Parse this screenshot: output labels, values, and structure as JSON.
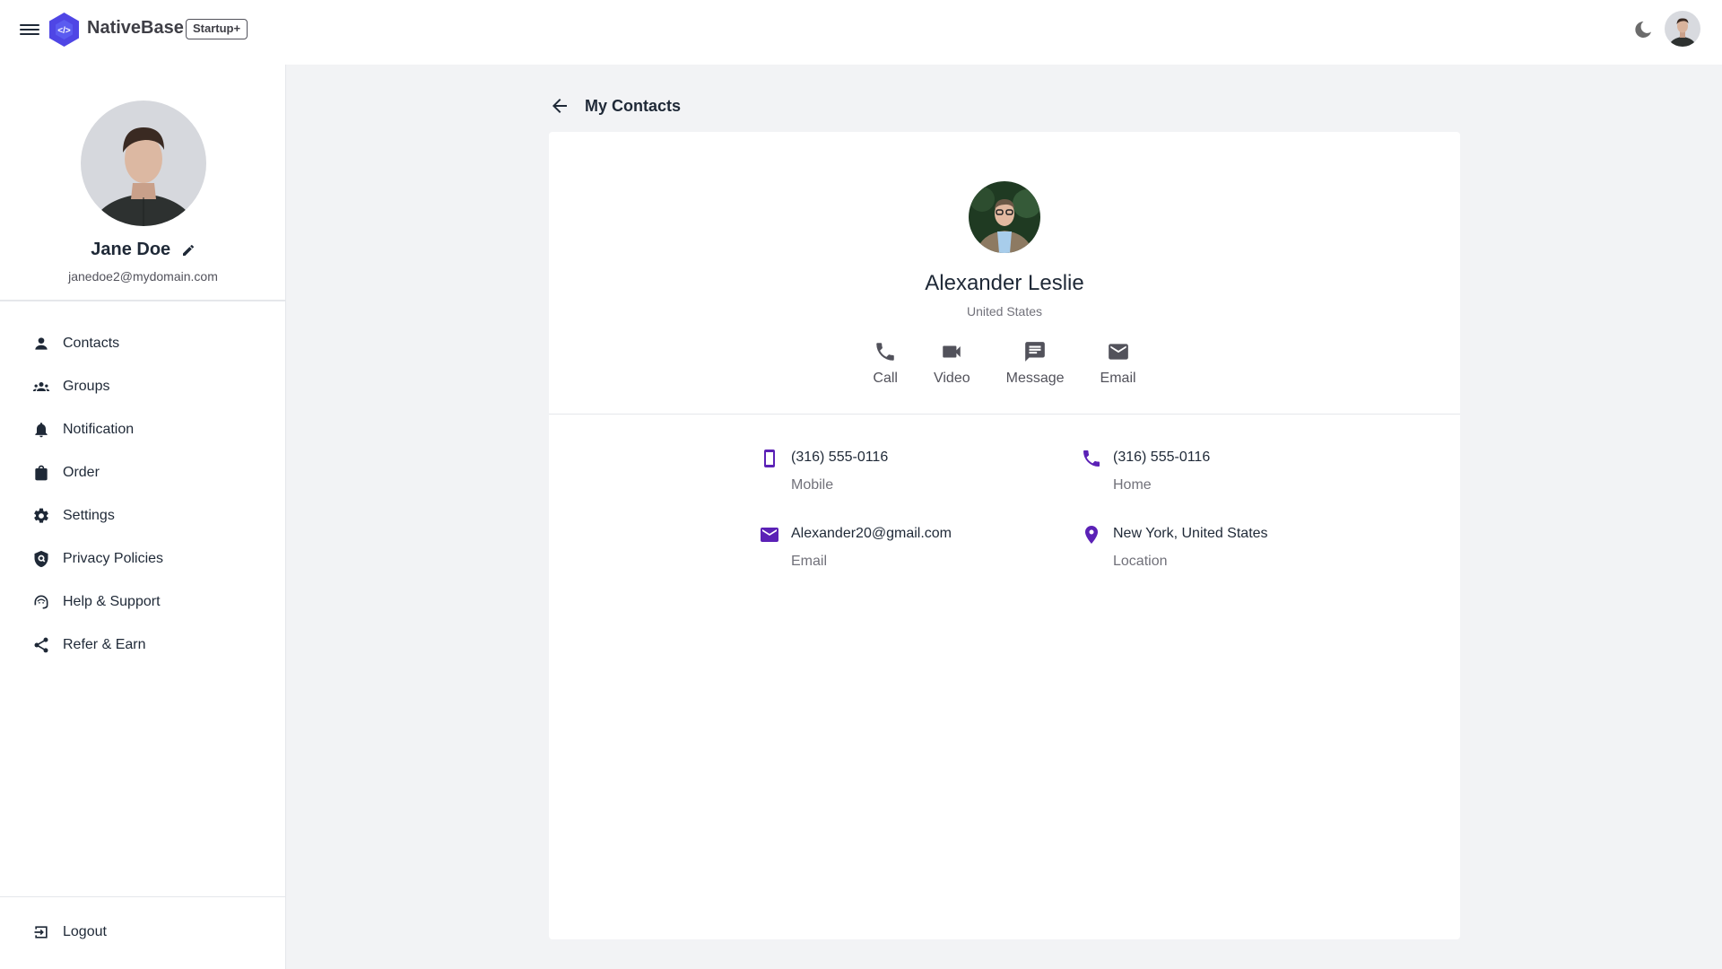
{
  "header": {
    "brand": "NativeBase",
    "plan_badge": "Startup+",
    "theme_toggle_icon": "moon-icon",
    "menu_icon": "hamburger-icon"
  },
  "sidebar": {
    "profile": {
      "name": "Jane Doe",
      "email": "janedoe2@mydomain.com"
    },
    "items": [
      {
        "label": "Contacts",
        "icon": "person-icon"
      },
      {
        "label": "Groups",
        "icon": "groups-icon"
      },
      {
        "label": "Notification",
        "icon": "bell-icon"
      },
      {
        "label": "Order",
        "icon": "shopping-bag-icon"
      },
      {
        "label": "Settings",
        "icon": "gear-icon"
      },
      {
        "label": "Privacy Policies",
        "icon": "shield-icon"
      },
      {
        "label": "Help & Support",
        "icon": "headset-icon"
      },
      {
        "label": "Refer & Earn",
        "icon": "share-icon"
      }
    ],
    "logout": {
      "label": "Logout",
      "icon": "logout-icon"
    }
  },
  "main": {
    "back_title": "My Contacts",
    "contact": {
      "name": "Alexander Leslie",
      "country": "United States",
      "actions": [
        {
          "label": "Call",
          "icon": "phone-icon"
        },
        {
          "label": "Video",
          "icon": "video-icon"
        },
        {
          "label": "Message",
          "icon": "message-icon"
        },
        {
          "label": "Email",
          "icon": "email-icon"
        }
      ],
      "details": [
        {
          "value": "(316) 555-0116",
          "kind": "Mobile",
          "icon": "mobile-icon"
        },
        {
          "value": "(316) 555-0116",
          "kind": "Home",
          "icon": "phone-icon"
        },
        {
          "value": "Alexander20@gmail.com",
          "kind": "Email",
          "icon": "email-icon"
        },
        {
          "value": "New York, United States",
          "kind": "Location",
          "icon": "location-pin-icon"
        }
      ]
    }
  },
  "colors": {
    "accent": "#5b21b6",
    "brand": "#4f46e5",
    "text": "#1f2937",
    "muted": "#71717a",
    "background": "#f2f3f5"
  }
}
